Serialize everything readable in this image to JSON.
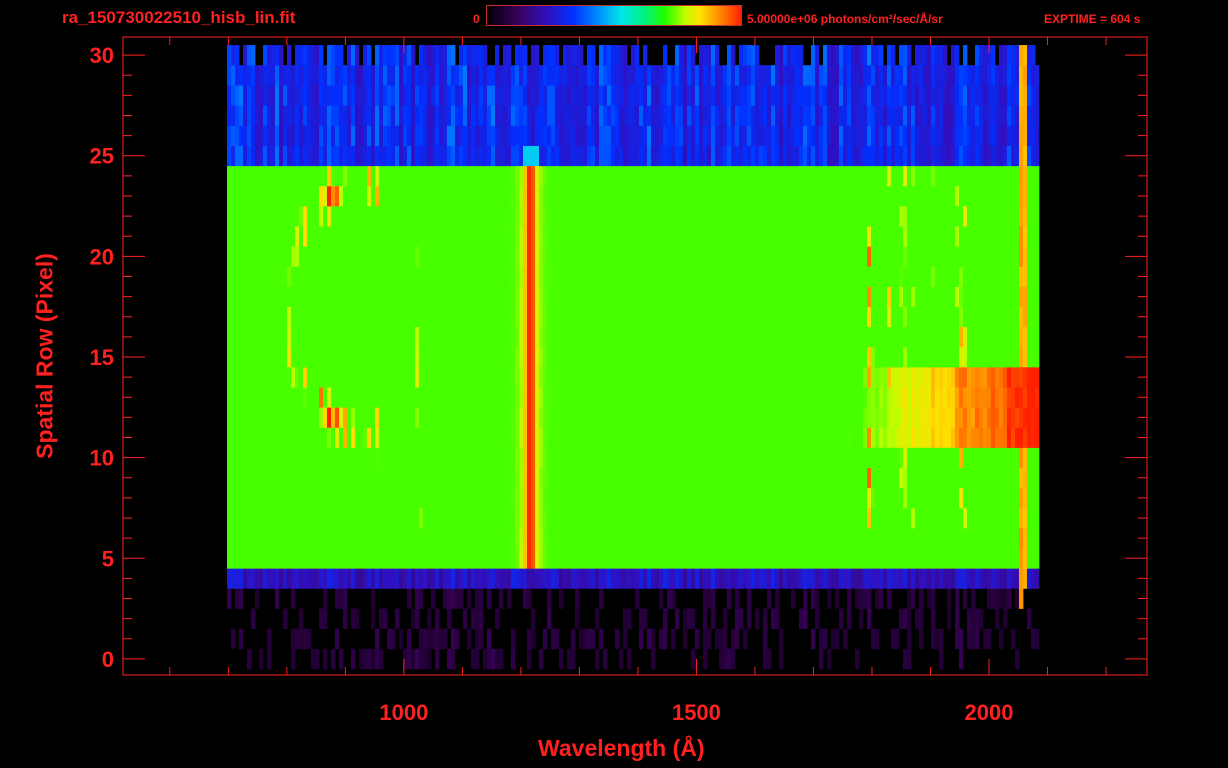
{
  "header": {
    "file_title": "ra_150730022510_hisb_lin.fit",
    "colorbar_min": "0",
    "colorbar_max": "5.00000e+06 photons/cm²/sec/Å/sr",
    "exptime": "EXPTIME = 604 s"
  },
  "colors": {
    "axis": "#ff2020",
    "background": "#000000"
  },
  "chart_data": {
    "type": "heatmap",
    "xlabel": "Wavelength (Å)",
    "ylabel": "Spatial Row (Pixel)",
    "xlim": [
      520,
      2270
    ],
    "ylim": [
      0,
      30
    ],
    "xticks": [
      "1000",
      "1500",
      "2000"
    ],
    "xtick_values": [
      1000,
      1500,
      2000
    ],
    "yticks": [
      "0",
      "5",
      "10",
      "15",
      "20",
      "25",
      "30"
    ],
    "ytick_values": [
      0,
      5,
      10,
      15,
      20,
      25,
      30
    ],
    "colorbar": {
      "min": 0,
      "max": 5000000,
      "unit": "photons/cm²/sec/Å/sr"
    },
    "features": {
      "slit_rows": [
        7,
        24
      ],
      "emission_line_wavelength": 1216,
      "bright_band_rows": [
        11,
        14
      ],
      "detector_edge_wavelength": 2060
    }
  }
}
